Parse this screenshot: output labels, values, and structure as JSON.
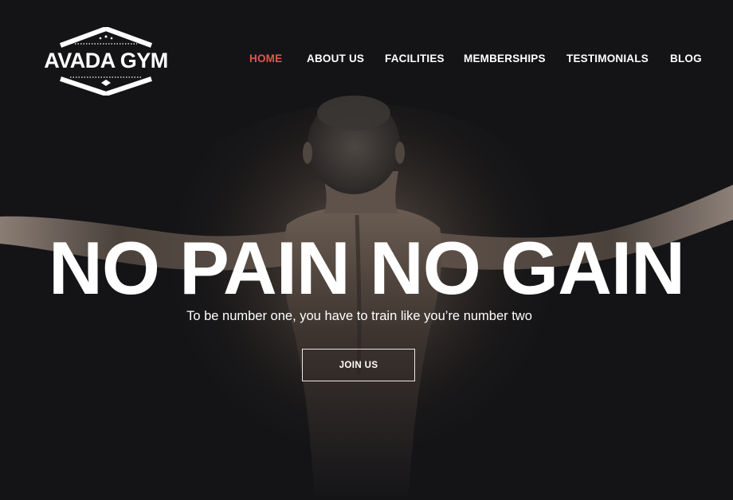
{
  "brand": {
    "name": "AVADA GYM"
  },
  "nav": {
    "items": [
      {
        "label": "HOME",
        "active": true
      },
      {
        "label": "ABOUT US",
        "active": false
      },
      {
        "label": "FACILITIES",
        "active": false
      },
      {
        "label": "MEMBERSHIPS",
        "active": false
      },
      {
        "label": "TESTIMONIALS",
        "active": false
      },
      {
        "label": "BLOG",
        "active": false
      }
    ]
  },
  "hero": {
    "headline": "NO PAIN NO GAIN",
    "subline": "To be number one, you have to train like you’re number two",
    "cta_label": "JOIN US"
  },
  "colors": {
    "background": "#141417",
    "nav_active": "#e0574f",
    "text": "#ffffff"
  }
}
